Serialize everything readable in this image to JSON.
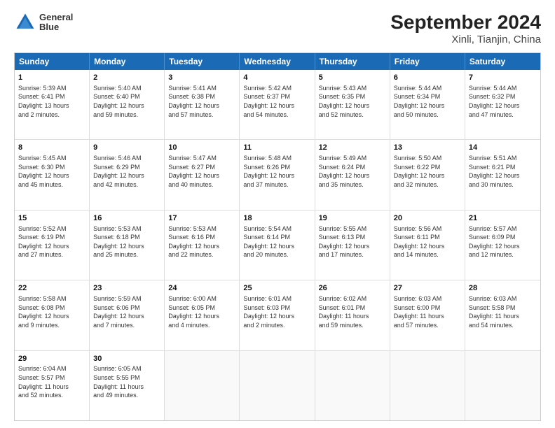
{
  "logo": {
    "line1": "General",
    "line2": "Blue"
  },
  "title": "September 2024",
  "subtitle": "Xinli, Tianjin, China",
  "weekdays": [
    "Sunday",
    "Monday",
    "Tuesday",
    "Wednesday",
    "Thursday",
    "Friday",
    "Saturday"
  ],
  "rows": [
    [
      {
        "day": "1",
        "info": "Sunrise: 5:39 AM\nSunset: 6:41 PM\nDaylight: 13 hours\nand 2 minutes."
      },
      {
        "day": "2",
        "info": "Sunrise: 5:40 AM\nSunset: 6:40 PM\nDaylight: 12 hours\nand 59 minutes."
      },
      {
        "day": "3",
        "info": "Sunrise: 5:41 AM\nSunset: 6:38 PM\nDaylight: 12 hours\nand 57 minutes."
      },
      {
        "day": "4",
        "info": "Sunrise: 5:42 AM\nSunset: 6:37 PM\nDaylight: 12 hours\nand 54 minutes."
      },
      {
        "day": "5",
        "info": "Sunrise: 5:43 AM\nSunset: 6:35 PM\nDaylight: 12 hours\nand 52 minutes."
      },
      {
        "day": "6",
        "info": "Sunrise: 5:44 AM\nSunset: 6:34 PM\nDaylight: 12 hours\nand 50 minutes."
      },
      {
        "day": "7",
        "info": "Sunrise: 5:44 AM\nSunset: 6:32 PM\nDaylight: 12 hours\nand 47 minutes."
      }
    ],
    [
      {
        "day": "8",
        "info": "Sunrise: 5:45 AM\nSunset: 6:30 PM\nDaylight: 12 hours\nand 45 minutes."
      },
      {
        "day": "9",
        "info": "Sunrise: 5:46 AM\nSunset: 6:29 PM\nDaylight: 12 hours\nand 42 minutes."
      },
      {
        "day": "10",
        "info": "Sunrise: 5:47 AM\nSunset: 6:27 PM\nDaylight: 12 hours\nand 40 minutes."
      },
      {
        "day": "11",
        "info": "Sunrise: 5:48 AM\nSunset: 6:26 PM\nDaylight: 12 hours\nand 37 minutes."
      },
      {
        "day": "12",
        "info": "Sunrise: 5:49 AM\nSunset: 6:24 PM\nDaylight: 12 hours\nand 35 minutes."
      },
      {
        "day": "13",
        "info": "Sunrise: 5:50 AM\nSunset: 6:22 PM\nDaylight: 12 hours\nand 32 minutes."
      },
      {
        "day": "14",
        "info": "Sunrise: 5:51 AM\nSunset: 6:21 PM\nDaylight: 12 hours\nand 30 minutes."
      }
    ],
    [
      {
        "day": "15",
        "info": "Sunrise: 5:52 AM\nSunset: 6:19 PM\nDaylight: 12 hours\nand 27 minutes."
      },
      {
        "day": "16",
        "info": "Sunrise: 5:53 AM\nSunset: 6:18 PM\nDaylight: 12 hours\nand 25 minutes."
      },
      {
        "day": "17",
        "info": "Sunrise: 5:53 AM\nSunset: 6:16 PM\nDaylight: 12 hours\nand 22 minutes."
      },
      {
        "day": "18",
        "info": "Sunrise: 5:54 AM\nSunset: 6:14 PM\nDaylight: 12 hours\nand 20 minutes."
      },
      {
        "day": "19",
        "info": "Sunrise: 5:55 AM\nSunset: 6:13 PM\nDaylight: 12 hours\nand 17 minutes."
      },
      {
        "day": "20",
        "info": "Sunrise: 5:56 AM\nSunset: 6:11 PM\nDaylight: 12 hours\nand 14 minutes."
      },
      {
        "day": "21",
        "info": "Sunrise: 5:57 AM\nSunset: 6:09 PM\nDaylight: 12 hours\nand 12 minutes."
      }
    ],
    [
      {
        "day": "22",
        "info": "Sunrise: 5:58 AM\nSunset: 6:08 PM\nDaylight: 12 hours\nand 9 minutes."
      },
      {
        "day": "23",
        "info": "Sunrise: 5:59 AM\nSunset: 6:06 PM\nDaylight: 12 hours\nand 7 minutes."
      },
      {
        "day": "24",
        "info": "Sunrise: 6:00 AM\nSunset: 6:05 PM\nDaylight: 12 hours\nand 4 minutes."
      },
      {
        "day": "25",
        "info": "Sunrise: 6:01 AM\nSunset: 6:03 PM\nDaylight: 12 hours\nand 2 minutes."
      },
      {
        "day": "26",
        "info": "Sunrise: 6:02 AM\nSunset: 6:01 PM\nDaylight: 11 hours\nand 59 minutes."
      },
      {
        "day": "27",
        "info": "Sunrise: 6:03 AM\nSunset: 6:00 PM\nDaylight: 11 hours\nand 57 minutes."
      },
      {
        "day": "28",
        "info": "Sunrise: 6:03 AM\nSunset: 5:58 PM\nDaylight: 11 hours\nand 54 minutes."
      }
    ],
    [
      {
        "day": "29",
        "info": "Sunrise: 6:04 AM\nSunset: 5:57 PM\nDaylight: 11 hours\nand 52 minutes."
      },
      {
        "day": "30",
        "info": "Sunrise: 6:05 AM\nSunset: 5:55 PM\nDaylight: 11 hours\nand 49 minutes."
      },
      {
        "day": "",
        "info": ""
      },
      {
        "day": "",
        "info": ""
      },
      {
        "day": "",
        "info": ""
      },
      {
        "day": "",
        "info": ""
      },
      {
        "day": "",
        "info": ""
      }
    ]
  ]
}
